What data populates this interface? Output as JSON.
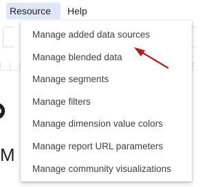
{
  "menubar": {
    "items": [
      {
        "label": "Resource",
        "active": true
      },
      {
        "label": "Help",
        "active": false
      }
    ]
  },
  "background": {
    "visible_letter": "M"
  },
  "dropdown": {
    "items": [
      {
        "label": "Manage added data sources"
      },
      {
        "label": "Manage blended data"
      },
      {
        "label": "Manage segments"
      },
      {
        "label": "Manage filters"
      },
      {
        "label": "Manage dimension value colors"
      },
      {
        "label": "Manage report URL parameters"
      },
      {
        "label": "Manage community visualizations"
      }
    ]
  },
  "annotation": {
    "arrow_color": "#b71c1c",
    "points_to": "Manage added data sources"
  },
  "colors": {
    "active_menu_bg": "#dfe7f7",
    "menu_text": "#3c4043"
  }
}
